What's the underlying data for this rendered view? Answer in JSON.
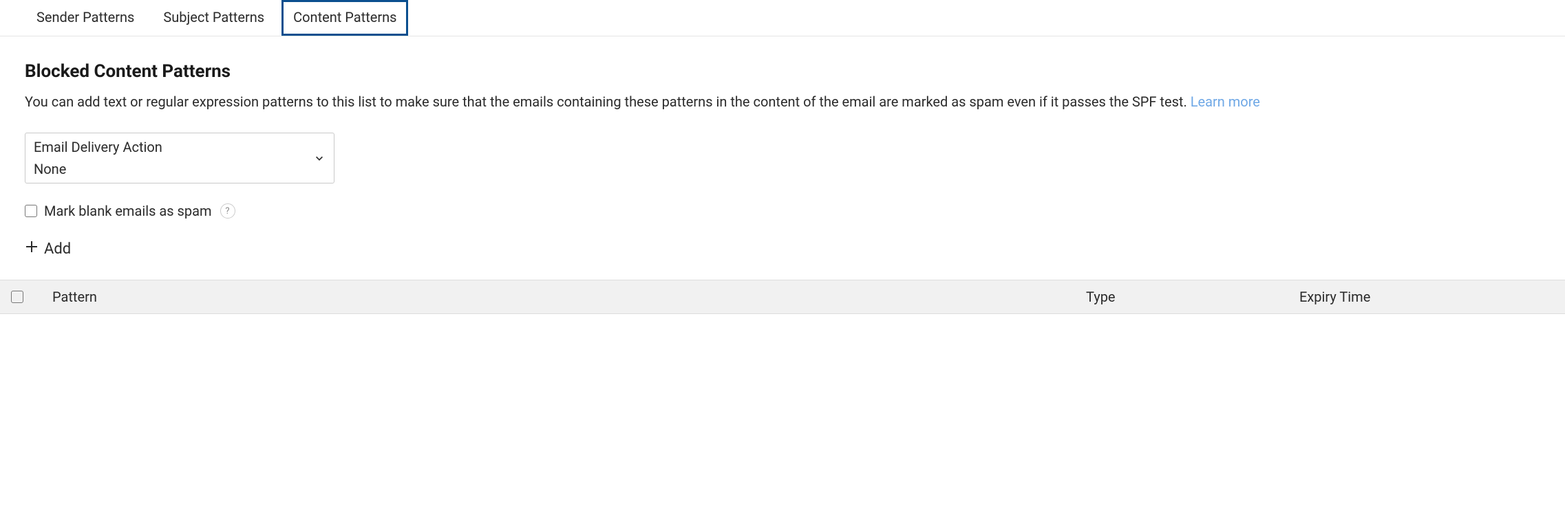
{
  "tabs": [
    {
      "label": "Sender Patterns",
      "active": false
    },
    {
      "label": "Subject Patterns",
      "active": false
    },
    {
      "label": "Content Patterns",
      "active": true
    }
  ],
  "page": {
    "title": "Blocked Content Patterns",
    "description_prefix": "You can add text or regular expression patterns to this list to make sure that the emails containing these patterns in the content of the email are marked as spam even if it passes the SPF test.",
    "learn_more": "Learn more"
  },
  "delivery_action": {
    "label": "Email Delivery Action",
    "value": "None"
  },
  "mark_blank": {
    "label": "Mark blank emails as spam",
    "help": "?"
  },
  "add_button": {
    "label": "Add"
  },
  "table": {
    "columns": {
      "pattern": "Pattern",
      "type": "Type",
      "expiry": "Expiry Time"
    }
  }
}
